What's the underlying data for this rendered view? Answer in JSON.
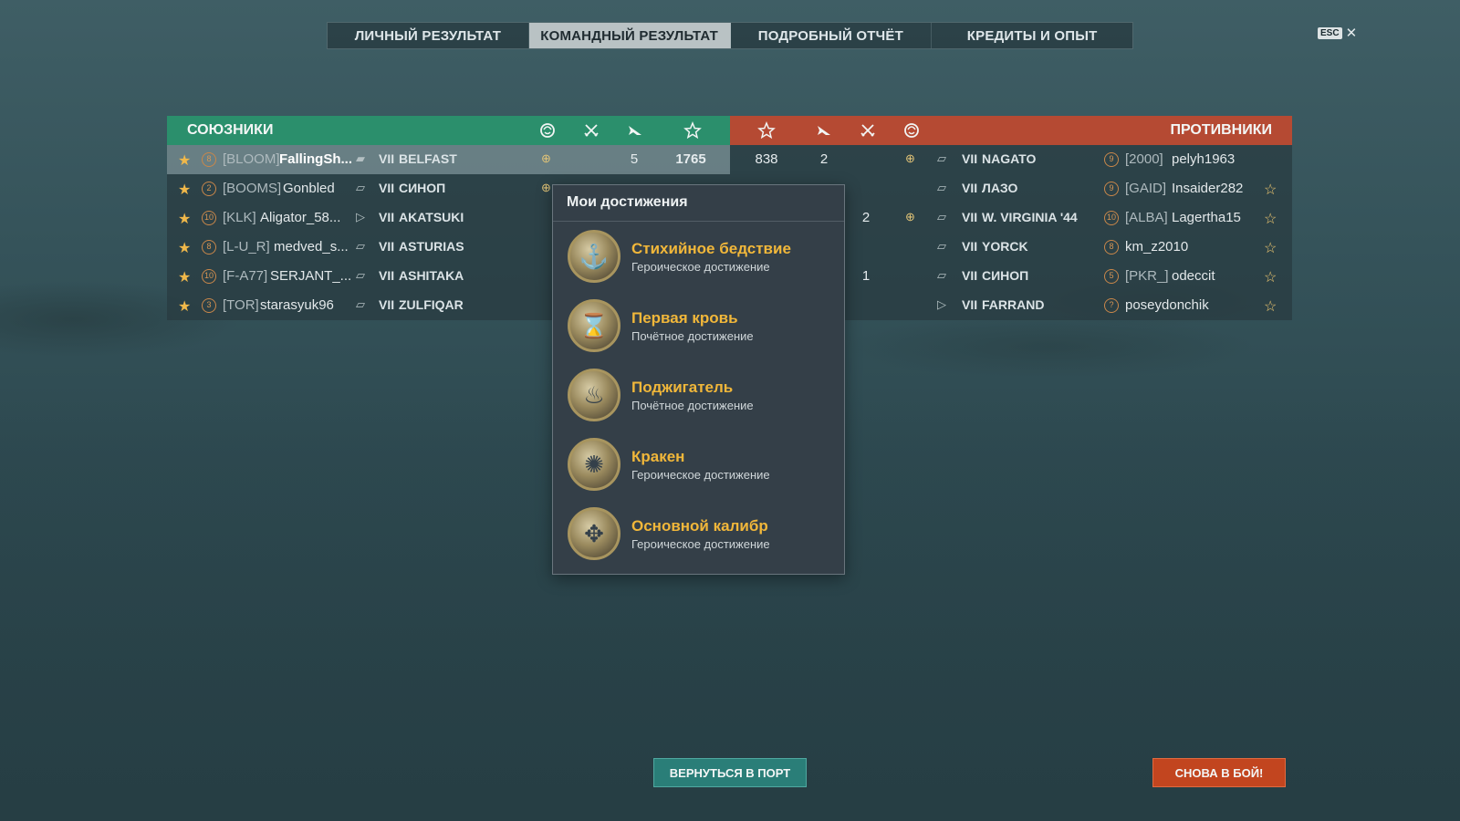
{
  "tabs": [
    {
      "label": "ЛИЧНЫЙ РЕЗУЛЬТАТ"
    },
    {
      "label": "КОМАНДНЫЙ РЕЗУЛЬТАТ",
      "active": true
    },
    {
      "label": "ПОДРОБНЫЙ ОТЧЁТ"
    },
    {
      "label": "КРЕДИТЫ И ОПЫТ"
    }
  ],
  "esc": {
    "key": "ESC",
    "close": "✕"
  },
  "allies": {
    "title": "СОЮЗНИКИ",
    "rows": [
      {
        "rank": "8",
        "clan": "[BLOOM]",
        "name": "FallingSh...",
        "tier": "VII",
        "ship": "BELFAST",
        "kills": "5",
        "xp": "1765"
      },
      {
        "rank": "2",
        "clan": "[BOOMS]",
        "name": "Gonbled",
        "tier": "VII",
        "ship": "СИНОП"
      },
      {
        "rank": "10",
        "clan": "[KLK]",
        "name": "Aligator_58...",
        "tier": "VII",
        "ship": "AKATSUKI"
      },
      {
        "rank": "8",
        "clan": "[L-U_R]",
        "name": "medved_s...",
        "tier": "VII",
        "ship": "ASTURIAS"
      },
      {
        "rank": "10",
        "clan": "[F-A77]",
        "name": "SERJANT_...",
        "tier": "VII",
        "ship": "ASHITAKA"
      },
      {
        "rank": "3",
        "clan": "[TOR]",
        "name": "starasyuk96",
        "tier": "VII",
        "ship": "ZULFIQAR"
      }
    ]
  },
  "enemies": {
    "title": "ПРОТИВНИКИ",
    "rows": [
      {
        "xp": "838",
        "kills": "2",
        "tier": "VII",
        "ship": "NAGATO",
        "rank": "9",
        "clan": "[2000]",
        "name": "pelyh1963"
      },
      {
        "tier": "VII",
        "ship": "ЛАЗО",
        "rank": "9",
        "clan": "[GAID]",
        "name": "Insaider282"
      },
      {
        "plane": "2",
        "tier": "VII",
        "ship": "W. VIRGINIA '44",
        "rank": "10",
        "clan": "[ALBA]",
        "name": "Lagertha15"
      },
      {
        "tier": "VII",
        "ship": "YORCK",
        "rank": "8",
        "clan": "",
        "name": "km_z2010"
      },
      {
        "plane": "1",
        "tier": "VII",
        "ship": "СИНОП",
        "rank": "5",
        "clan": "[PKR_]",
        "name": "odeccit"
      },
      {
        "tier": "VII",
        "ship": "FARRAND",
        "rank": "?",
        "clan": "",
        "name": "poseydonchik"
      }
    ]
  },
  "popup": {
    "title": "Мои достижения",
    "achievements": [
      {
        "name": "Стихийное бедствие",
        "sub": "Героическое достижение"
      },
      {
        "name": "Первая кровь",
        "sub": "Почётное достижение"
      },
      {
        "name": "Поджигатель",
        "sub": "Почётное достижение"
      },
      {
        "name": "Кракен",
        "sub": "Героическое достижение"
      },
      {
        "name": "Основной калибр",
        "sub": "Героическое достижение"
      }
    ]
  },
  "buttons": {
    "port": "ВЕРНУТЬСЯ В ПОРТ",
    "battle": "СНОВА В БОЙ!"
  },
  "colors": {
    "ally_header": "#2b8f6c",
    "enemy_header": "#b54a33",
    "achievement_name": "#f1b73a",
    "battle_button": "#c2451f",
    "port_button": "#2a7e78"
  }
}
